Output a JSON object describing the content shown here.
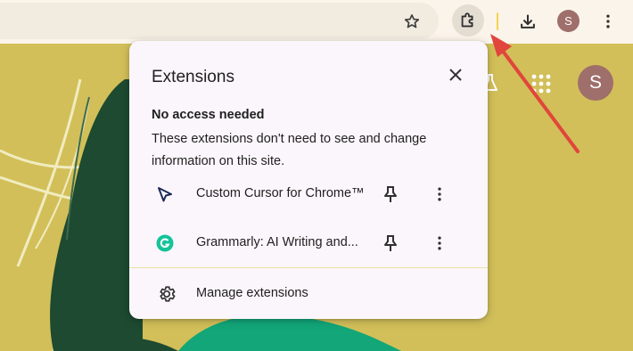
{
  "popup": {
    "title": "Extensions",
    "section_heading": "No access needed",
    "section_description": "These extensions don't need to see and change information on this site.",
    "extensions": [
      {
        "name": "Custom Cursor for Chrome™",
        "icon": "cursor-arrow-icon"
      },
      {
        "name": "Grammarly: AI Writing and...",
        "icon": "grammarly-icon"
      }
    ],
    "manage_label": "Manage extensions"
  },
  "toolbar": {
    "profile_initial": "S",
    "icons": [
      "bookmark-star-icon",
      "extensions-puzzle-icon",
      "download-icon",
      "more-vert-icon"
    ]
  },
  "page": {
    "profile_initial": "S",
    "icons": [
      "labs-flask-icon",
      "apps-grid-icon"
    ]
  },
  "colors": {
    "arrow": "#e0463c",
    "page_background": "#d2bf59",
    "avatar": "#9f6f6b",
    "grammarly": "#15c39a"
  }
}
